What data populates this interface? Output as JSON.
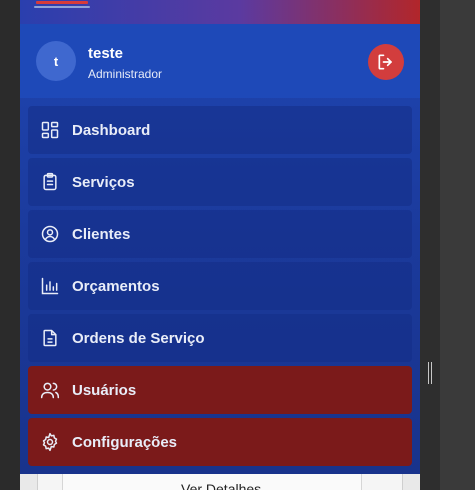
{
  "user": {
    "initial": "t",
    "name": "teste",
    "role": "Administrador"
  },
  "nav": [
    {
      "label": "Dashboard",
      "icon": "dashboard-icon",
      "active": false
    },
    {
      "label": "Serviços",
      "icon": "clipboard-icon",
      "active": false
    },
    {
      "label": "Clientes",
      "icon": "user-circle-icon",
      "active": false
    },
    {
      "label": "Orçamentos",
      "icon": "bar-chart-icon",
      "active": false
    },
    {
      "label": "Ordens de Serviço",
      "icon": "document-icon",
      "active": false
    },
    {
      "label": "Usuários",
      "icon": "users-icon",
      "active": true
    },
    {
      "label": "Configurações",
      "icon": "gear-icon",
      "active": true
    }
  ],
  "below": {
    "button_label": "Ver Detalhes"
  },
  "colors": {
    "sidebar": "#1b3a9c",
    "active": "#7b1a1a",
    "logout": "#d23d3d"
  }
}
